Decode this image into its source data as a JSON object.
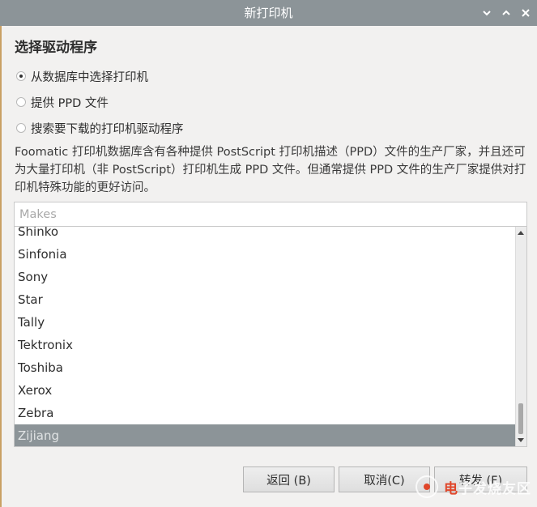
{
  "window": {
    "title": "新打印机"
  },
  "section": {
    "title": "选择驱动程序"
  },
  "options": [
    {
      "label": "从数据库中选择打印机",
      "checked": true
    },
    {
      "label": "提供 PPD 文件",
      "checked": false
    },
    {
      "label": "搜索要下载的打印机驱动程序",
      "checked": false
    }
  ],
  "description": "Foomatic 打印机数据库含有各种提供 PostScript 打印机描述（PPD）文件的生产厂家，并且还可为大量打印机（非 PostScript）打印机生成 PPD 文件。但通常提供 PPD 文件的生产厂家提供对打印机特殊功能的更好访问。",
  "search": {
    "placeholder": "Makes",
    "value": ""
  },
  "makes": {
    "items": [
      "Shinko",
      "Sinfonia",
      "Sony",
      "Star",
      "Tally",
      "Tektronix",
      "Toshiba",
      "Xerox",
      "Zebra",
      "Zijiang"
    ],
    "selected": "Zijiang"
  },
  "buttons": {
    "back": "返回 (B)",
    "cancel": "取消(C)",
    "forward": "转发 (F)"
  },
  "watermark": {
    "text_prefix": "电",
    "text_rest": "子发烧友",
    "suffix": "区"
  },
  "colors": {
    "titlebar": "#8c9498",
    "selection": "#8c9498",
    "background": "#f2f1f0"
  }
}
